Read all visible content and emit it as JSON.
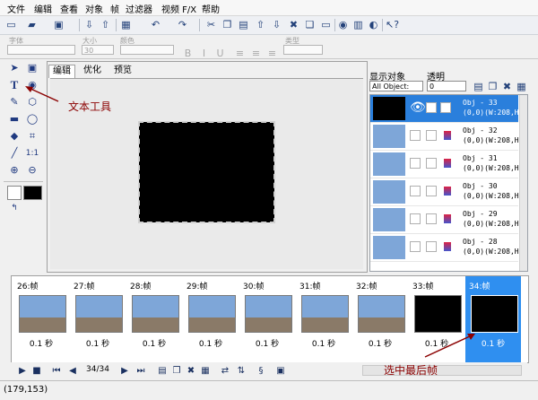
{
  "menu": [
    "文件",
    "编辑",
    "查看",
    "对象",
    "帧",
    "过滤器",
    "视频 F/X",
    "帮助"
  ],
  "toolbar_icons": [
    "new-file-icon",
    "open-folder-icon",
    "save-icon",
    "import-icon",
    "export-icon",
    "paint-icon",
    "undo-icon",
    "redo-icon",
    "cut-icon",
    "copy-icon",
    "paste-icon",
    "delete-icon",
    "duplicate-icon",
    "align-icon",
    "grid-icon",
    "color-icon",
    "globe-icon",
    "help-pointer-icon"
  ],
  "props": {
    "font_label": "字体",
    "size_label": "大小",
    "size_value": "30",
    "color_label": "颜色",
    "type_label": "类型"
  },
  "work_tabs": [
    "编辑",
    "优化",
    "预览"
  ],
  "objects": {
    "display_label": "显示对象",
    "opacity_label": "透明",
    "filter_value": "All Object:",
    "opacity_value": "0",
    "rows": [
      {
        "name": "Obj - 33",
        "coords": "(0,0)(W:208,H:",
        "selected": true
      },
      {
        "name": "Obj - 32",
        "coords": "(0,0)(W:208,H:",
        "selected": false
      },
      {
        "name": "Obj - 31",
        "coords": "(0,0)(W:208,H:",
        "selected": false
      },
      {
        "name": "Obj - 30",
        "coords": "(0,0)(W:208,H:",
        "selected": false
      },
      {
        "name": "Obj - 29",
        "coords": "(0,0)(W:208,H:",
        "selected": false
      },
      {
        "name": "Obj - 28",
        "coords": "(0,0)(W:208,H:",
        "selected": false
      }
    ]
  },
  "frames": [
    {
      "label": "26:帧",
      "time": "0.1 秒",
      "black": false
    },
    {
      "label": "27:帧",
      "time": "0.1 秒",
      "black": false
    },
    {
      "label": "28:帧",
      "time": "0.1 秒",
      "black": false
    },
    {
      "label": "29:帧",
      "time": "0.1 秒",
      "black": false
    },
    {
      "label": "30:帧",
      "time": "0.1 秒",
      "black": false
    },
    {
      "label": "31:帧",
      "time": "0.1 秒",
      "black": false
    },
    {
      "label": "32:帧",
      "time": "0.1 秒",
      "black": false
    },
    {
      "label": "33:帧",
      "time": "0.1 秒",
      "black": true
    },
    {
      "label": "34:帧",
      "time": "0.1 秒",
      "black": true,
      "selected": true
    }
  ],
  "playback": {
    "counter": "34/34"
  },
  "status": {
    "coords": "(179,153)"
  },
  "annotations": {
    "text_tool": "文本工具",
    "select_last": "选中最后帧"
  },
  "colors": {
    "accent": "#2f8ff0",
    "annotation": "#8b0000"
  }
}
